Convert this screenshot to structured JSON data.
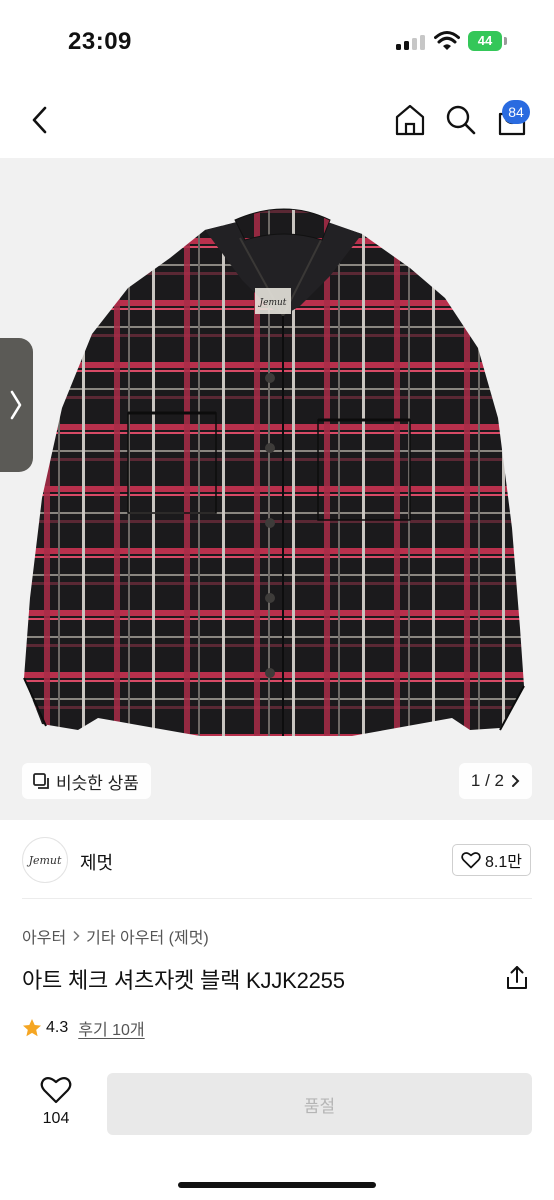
{
  "status_bar": {
    "time": "23:09",
    "battery": "44"
  },
  "header": {
    "cart_count": "84"
  },
  "gallery": {
    "image_label": "Jemut",
    "similar_label": "비슷한 상품",
    "page_indicator": "1 / 2"
  },
  "brand": {
    "logo_text": "Jemut",
    "name": "제멋",
    "likes": "8.1만"
  },
  "breadcrumb": {
    "category": "아우터",
    "subcategory": "기타 아우터 (제멋)"
  },
  "product": {
    "title": "아트 체크 셔츠자켓 블랙 KJJK2255",
    "rating": "4.3",
    "reviews": "후기 10개"
  },
  "bottom": {
    "wish_count": "104",
    "buy_label": "품절"
  },
  "colors": {
    "accent": "#2a6be0",
    "star": "#f5a623",
    "battery": "#34c759"
  }
}
